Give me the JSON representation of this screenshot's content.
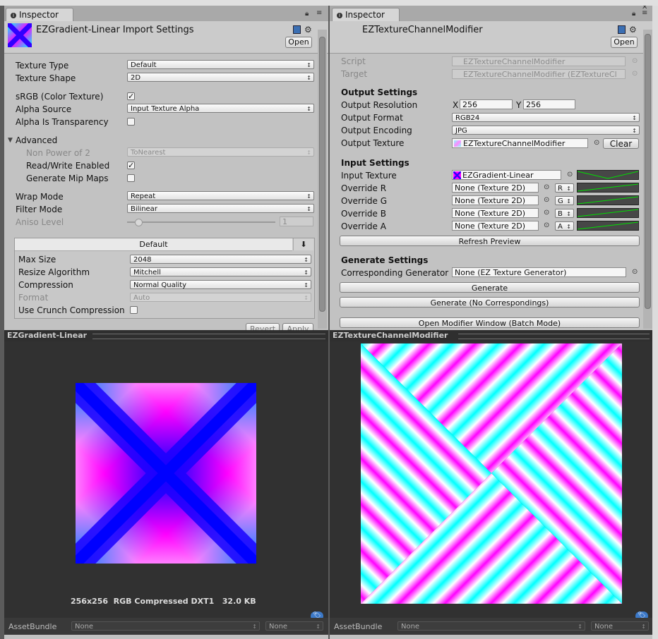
{
  "left": {
    "tab": "Inspector",
    "title": "EZGradient-Linear Import Settings",
    "open_button": "Open",
    "rows": {
      "texture_type": {
        "label": "Texture Type",
        "value": "Default"
      },
      "texture_shape": {
        "label": "Texture Shape",
        "value": "2D"
      },
      "srgb": {
        "label": "sRGB (Color Texture)",
        "checked": true
      },
      "alpha_source": {
        "label": "Alpha Source",
        "value": "Input Texture Alpha"
      },
      "alpha_transparency": {
        "label": "Alpha Is Transparency",
        "checked": false
      },
      "advanced": {
        "label": "Advanced"
      },
      "non_power_of_2": {
        "label": "Non Power of 2",
        "value": "ToNearest"
      },
      "read_write": {
        "label": "Read/Write Enabled",
        "checked": true
      },
      "mip_maps": {
        "label": "Generate Mip Maps",
        "checked": false
      },
      "wrap_mode": {
        "label": "Wrap Mode",
        "value": "Repeat"
      },
      "filter_mode": {
        "label": "Filter Mode",
        "value": "Bilinear"
      },
      "aniso_level": {
        "label": "Aniso Level",
        "value": "1"
      }
    },
    "platform": {
      "tab": "Default",
      "max_size": {
        "label": "Max Size",
        "value": "2048"
      },
      "resize_algorithm": {
        "label": "Resize Algorithm",
        "value": "Mitchell"
      },
      "compression": {
        "label": "Compression",
        "value": "Normal Quality"
      },
      "format": {
        "label": "Format",
        "value": "Auto"
      },
      "crunch": {
        "label": "Use Crunch Compression",
        "checked": false
      }
    },
    "revert": "Revert",
    "apply": "Apply",
    "preview": {
      "title": "EZGradient-Linear",
      "info": "256x256  RGB Compressed DXT1   32.0 KB"
    },
    "asset_bundle": {
      "label": "AssetBundle",
      "name": "None",
      "variant": "None"
    }
  },
  "right": {
    "tab": "Inspector",
    "title": "EZTextureChannelModifier",
    "open_button": "Open",
    "script": {
      "label": "Script",
      "value": "EZTextureChannelModifier"
    },
    "target": {
      "label": "Target",
      "value": "EZTextureChannelModifier (EZTextureCl"
    },
    "output_section": "Output Settings",
    "output_resolution": {
      "label": "Output Resolution",
      "x_label": "X",
      "x": "256",
      "y_label": "Y",
      "y": "256"
    },
    "output_format": {
      "label": "Output Format",
      "value": "RGB24"
    },
    "output_encoding": {
      "label": "Output Encoding",
      "value": "JPG"
    },
    "output_texture": {
      "label": "Output Texture",
      "value": "EZTextureChannelModifier",
      "clear": "Clear"
    },
    "input_section": "Input Settings",
    "input_texture": {
      "label": "Input Texture",
      "value": "EZGradient-Linear"
    },
    "overrides": [
      {
        "label": "Override R",
        "value": "None (Texture 2D)",
        "channel": "R"
      },
      {
        "label": "Override G",
        "value": "None (Texture 2D)",
        "channel": "G"
      },
      {
        "label": "Override B",
        "value": "None (Texture 2D)",
        "channel": "B"
      },
      {
        "label": "Override A",
        "value": "None (Texture 2D)",
        "channel": "A"
      }
    ],
    "refresh_preview": "Refresh Preview",
    "generate_section": "Generate Settings",
    "corresponding_generator": {
      "label": "Corresponding Generator",
      "value": "None (EZ Texture Generator)"
    },
    "generate": "Generate",
    "generate_no_corr": "Generate (No Correspondings)",
    "open_modifier_window": "Open Modifier Window (Batch Mode)",
    "preview": {
      "title": "EZTextureChannelModifier"
    },
    "asset_bundle": {
      "label": "AssetBundle",
      "name": "None",
      "variant": "None"
    }
  },
  "colors": {
    "panel_bg": "#c2c2c2",
    "preview_bg": "#313131",
    "gradient_magenta": "#ff00ff",
    "gradient_cyan": "#00ffff",
    "gradient_blue": "#0000ff",
    "curve_green": "#00e000",
    "tag_blue": "#3c79c8"
  }
}
